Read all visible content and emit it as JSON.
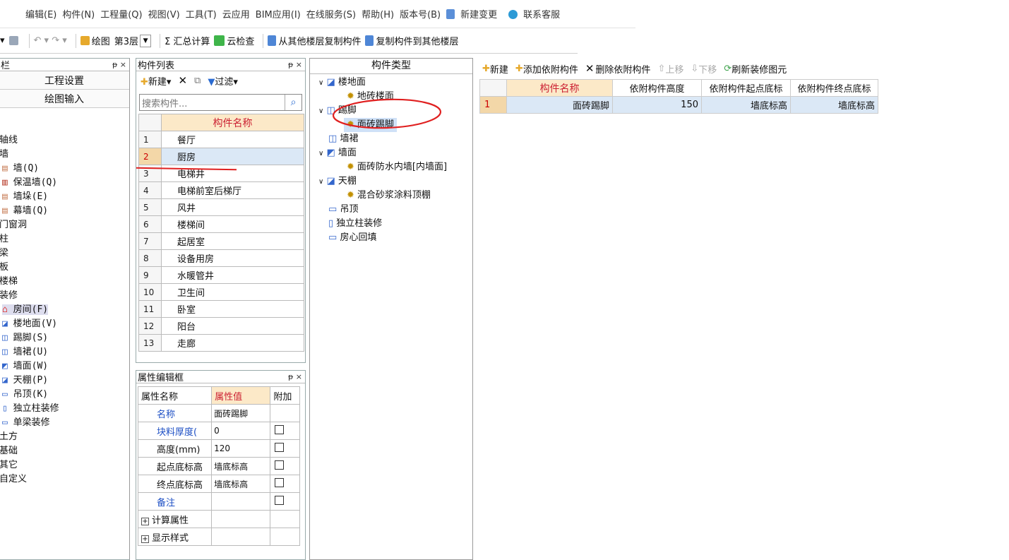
{
  "menubar": [
    "编辑(E)",
    "构件(N)",
    "工程量(Q)",
    "视图(V)",
    "工具(T)",
    "云应用",
    "BIM应用(I)",
    "在线服务(S)",
    "帮助(H)",
    "版本号(B)",
    "新建变更",
    "联系客服"
  ],
  "toolbar": {
    "draw": "绘图",
    "floor": "第3层",
    "sum": "Σ 汇总计算",
    "cloud_check": "云检查",
    "copy_from": "从其他楼层复制构件",
    "copy_to": "复制构件到其他楼层"
  },
  "leftnav": {
    "title": "栏",
    "buttons": [
      "工程设置",
      "绘图输入"
    ],
    "items": [
      "轴线",
      "墙",
      "墙(Q)",
      "保温墙(Q)",
      "墙垛(E)",
      "幕墙(Q)",
      "门窗洞",
      "柱",
      "梁",
      "板",
      "楼梯",
      "装修",
      "房间(F)",
      "楼地面(V)",
      "踢脚(S)",
      "墙裙(U)",
      "墙面(W)",
      "天棚(P)",
      "吊顶(K)",
      "独立柱装修",
      "单梁装修",
      "土方",
      "基础",
      "其它",
      "自定义"
    ]
  },
  "complist": {
    "title": "构件列表",
    "new_label": "新建",
    "filter_label": "过滤",
    "search_placeholder": "搜索构件...",
    "col_name": "构件名称",
    "rows": [
      {
        "n": "1",
        "name": "餐厅"
      },
      {
        "n": "2",
        "name": "厨房"
      },
      {
        "n": "3",
        "name": "电梯井"
      },
      {
        "n": "4",
        "name": "电梯前室后梯厅"
      },
      {
        "n": "5",
        "name": "风井"
      },
      {
        "n": "6",
        "name": "楼梯间"
      },
      {
        "n": "7",
        "name": "起居室"
      },
      {
        "n": "8",
        "name": "设备用房"
      },
      {
        "n": "9",
        "name": "水暖管井"
      },
      {
        "n": "10",
        "name": "卫生间"
      },
      {
        "n": "11",
        "name": "卧室"
      },
      {
        "n": "12",
        "name": "阳台"
      },
      {
        "n": "13",
        "name": "走廊"
      }
    ]
  },
  "attr": {
    "title": "属性编辑框",
    "col_name": "属性名称",
    "col_value": "属性值",
    "col_extra": "附加",
    "rows": [
      {
        "name": "名称",
        "value": "面砖踢脚"
      },
      {
        "name": "块料厚度(",
        "value": "0"
      },
      {
        "name": "高度(mm)",
        "value": "120"
      },
      {
        "name": "起点底标高",
        "value": "墙底标高"
      },
      {
        "name": "终点底标高",
        "value": "墙底标高"
      },
      {
        "name": "备注",
        "value": ""
      }
    ],
    "groups": [
      "计算属性",
      "显示样式"
    ]
  },
  "types": {
    "title": "构件类型",
    "tree": [
      {
        "label": "楼地面",
        "level": 0
      },
      {
        "label": "地砖楼面",
        "level": 1
      },
      {
        "label": "踢脚",
        "level": 0
      },
      {
        "label": "面砖踢脚",
        "level": 1
      },
      {
        "label": "墙裙",
        "level": 0
      },
      {
        "label": "墙面",
        "level": 0
      },
      {
        "label": "面砖防水内墙[内墙面]",
        "level": 1
      },
      {
        "label": "天棚",
        "level": 0
      },
      {
        "label": "混合砂浆涂料顶棚",
        "level": 1
      },
      {
        "label": "吊顶",
        "level": 0
      },
      {
        "label": "独立柱装修",
        "level": 0
      },
      {
        "label": "房心回填",
        "level": 0
      }
    ]
  },
  "right": {
    "tools": [
      "新建",
      "添加依附构件",
      "删除依附构件",
      "上移",
      "下移",
      "刷新装修图元"
    ],
    "headers": [
      "构件名称",
      "依附构件高度",
      "依附构件起点底标",
      "依附构件终点底标"
    ],
    "row": {
      "n": "1",
      "name": "面砖踢脚",
      "height": "150",
      "start": "墙底标高",
      "end": "墙底标高"
    }
  }
}
